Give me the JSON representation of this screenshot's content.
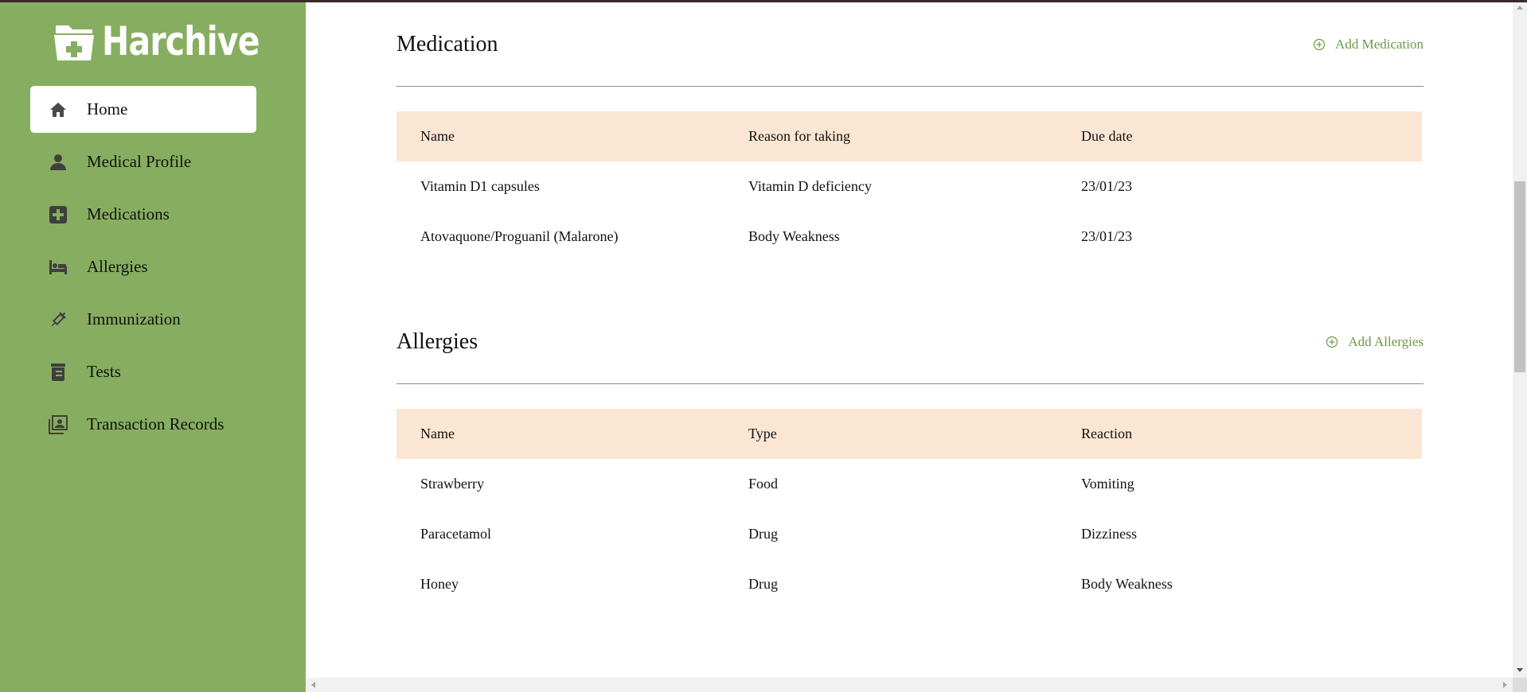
{
  "colors": {
    "sidebar_bg": "#87ae60",
    "accent": "#6a9a45",
    "table_header_bg": "#fbe6d3",
    "icon_dark": "#3f3f3f"
  },
  "app": {
    "name": "Harchive",
    "logo_icon": "folder-plus-icon"
  },
  "sidebar": {
    "items": [
      {
        "label": "Home",
        "icon": "home-icon",
        "active": true
      },
      {
        "label": "Medical Profile",
        "icon": "person-icon",
        "active": false
      },
      {
        "label": "Medications",
        "icon": "medical-plus-icon",
        "active": false
      },
      {
        "label": "Allergies",
        "icon": "hospital-bed-icon",
        "active": false
      },
      {
        "label": "Immunization",
        "icon": "syringe-icon",
        "active": false
      },
      {
        "label": "Tests",
        "icon": "test-jar-icon",
        "active": false
      },
      {
        "label": "Transaction Records",
        "icon": "records-icon",
        "active": false
      }
    ]
  },
  "medication": {
    "title": "Medication",
    "add_label": "Add Medication",
    "columns": [
      "Name",
      "Reason for taking",
      "Due date"
    ],
    "rows": [
      [
        "Vitamin D1 capsules",
        "Vitamin D deficiency",
        "23/01/23"
      ],
      [
        "Atovaquone/Proguanil (Malarone)",
        "Body Weakness",
        "23/01/23"
      ]
    ]
  },
  "allergies": {
    "title": "Allergies",
    "add_label": "Add Allergies",
    "columns": [
      "Name",
      "Type",
      "Reaction"
    ],
    "rows": [
      [
        "Strawberry",
        "Food",
        "Vomiting"
      ],
      [
        "Paracetamol",
        "Drug",
        "Dizziness"
      ],
      [
        "Honey",
        "Drug",
        "Body Weakness"
      ]
    ]
  }
}
